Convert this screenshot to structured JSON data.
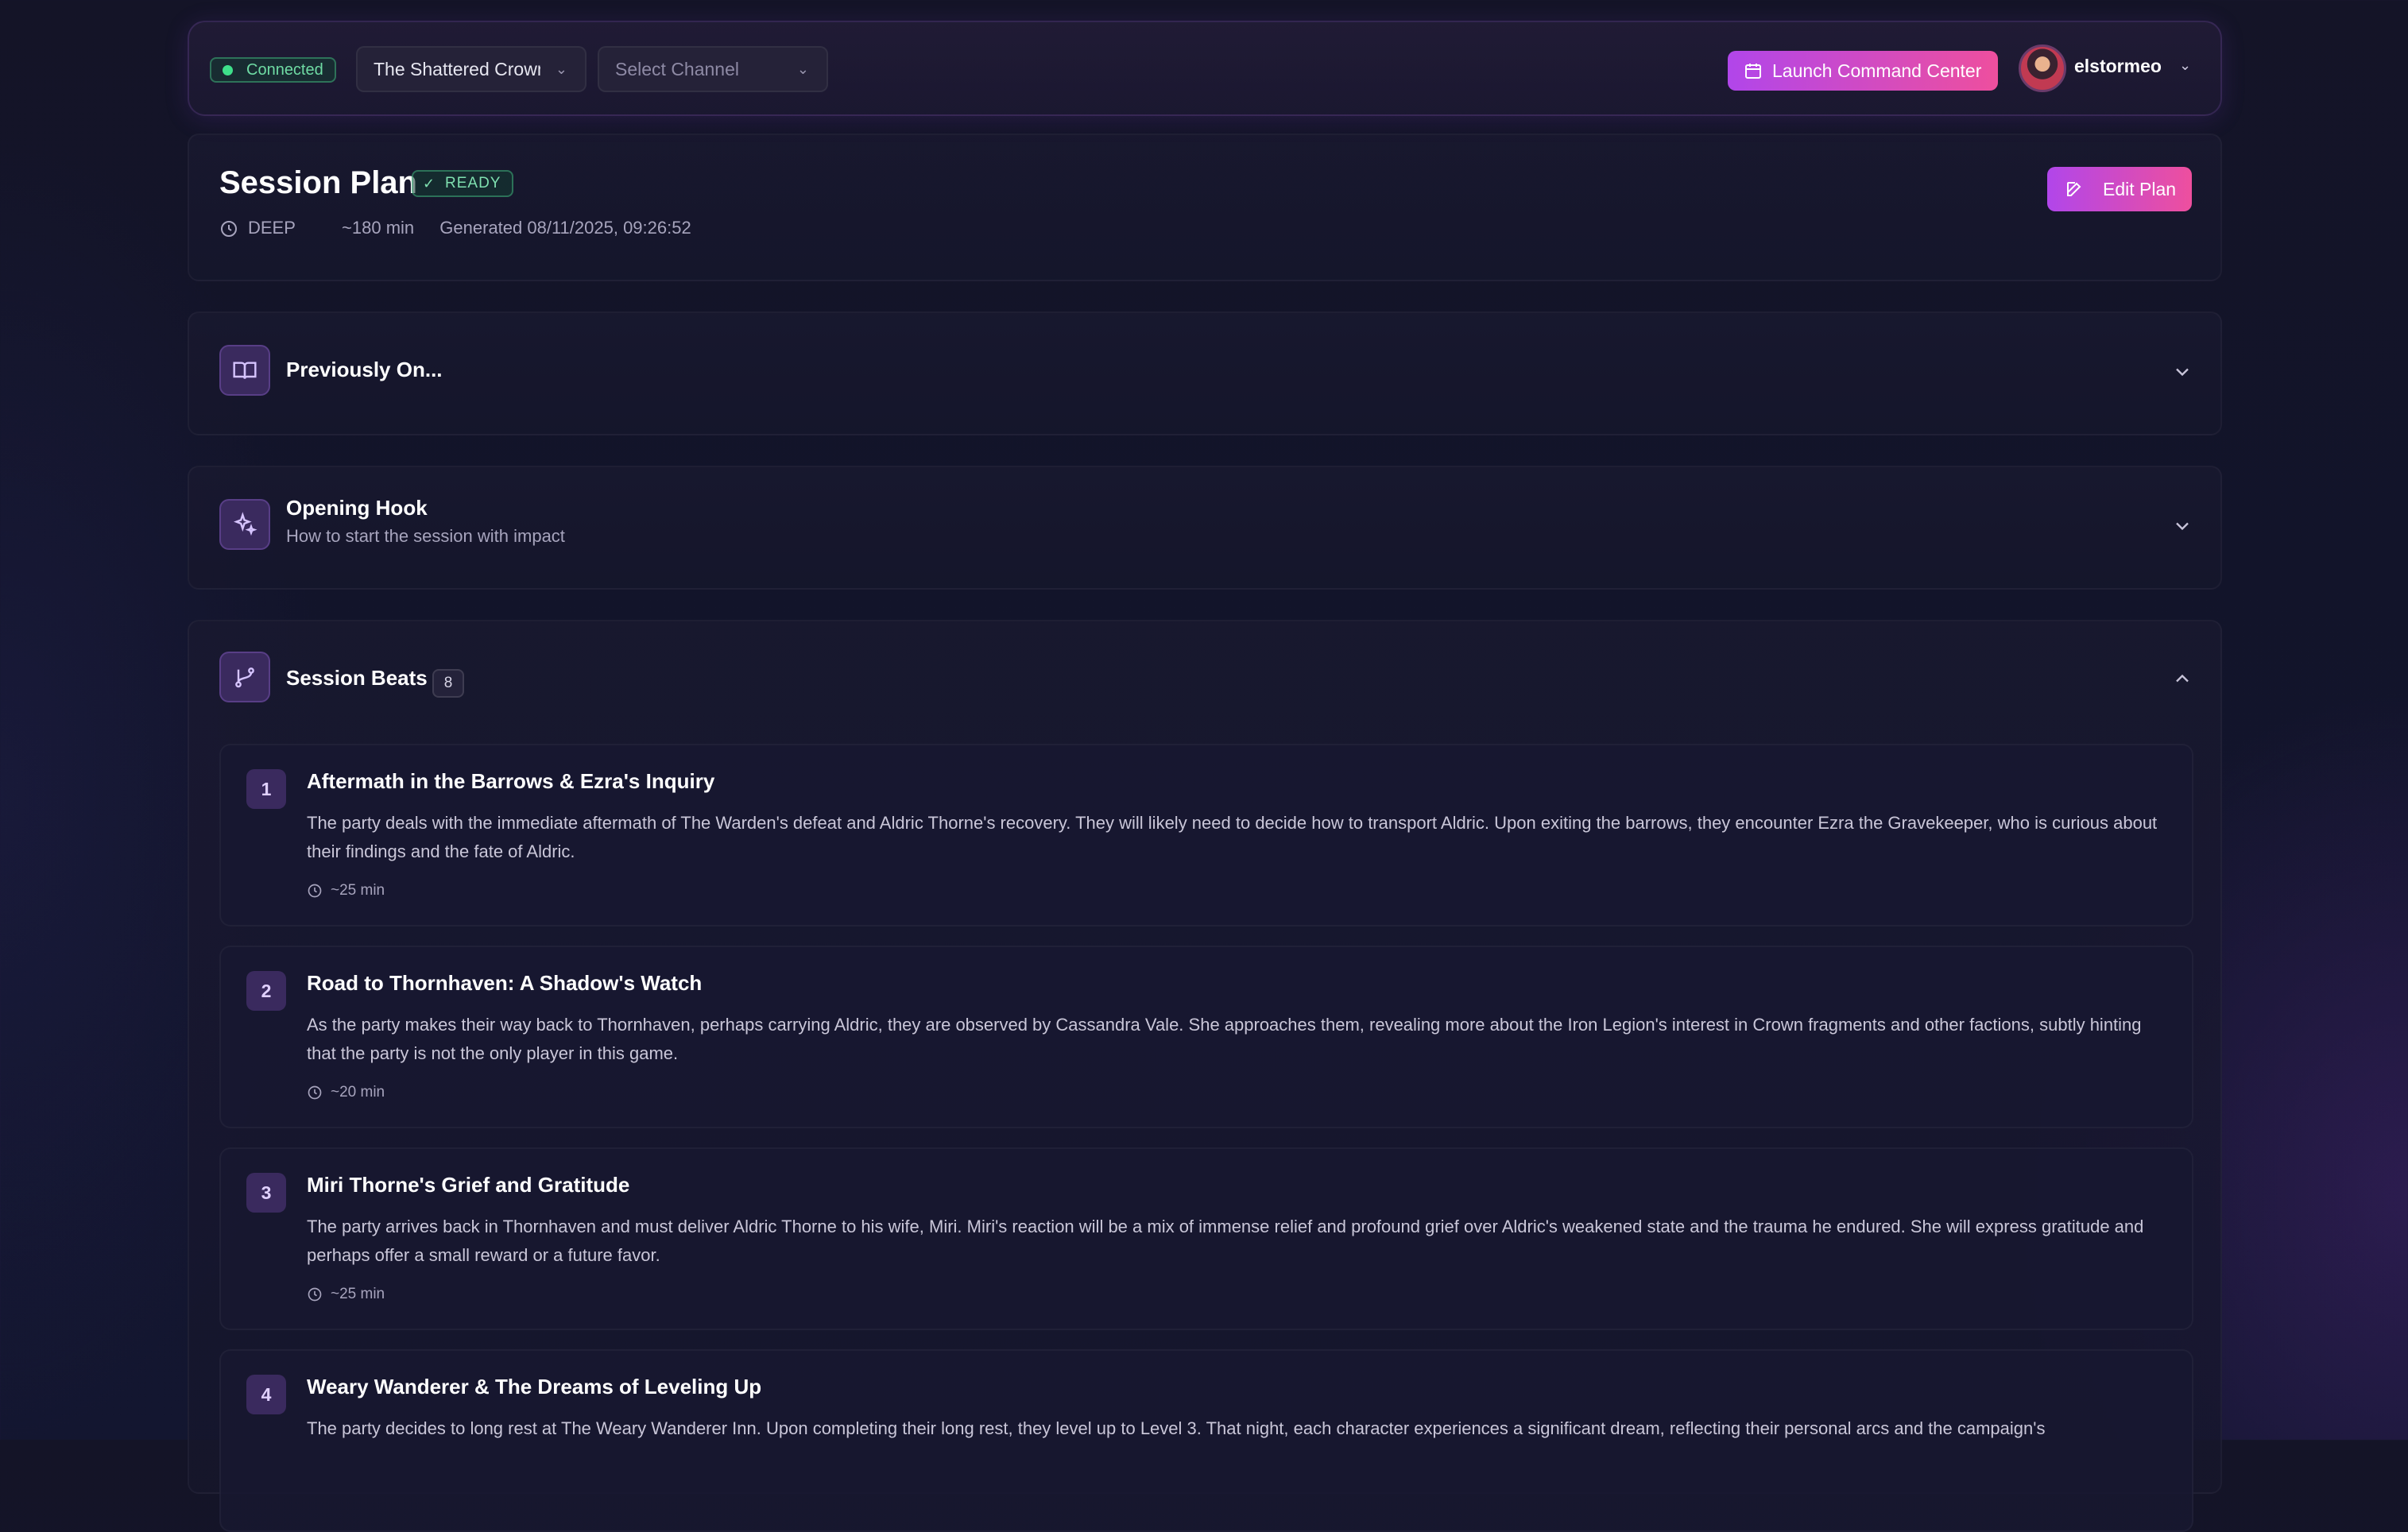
{
  "header": {
    "connection_status": "Connected",
    "campaign_select": "The Shattered Crown",
    "channel_placeholder": "Select Channel",
    "launch_label": "Launch Command Center",
    "username": "elstormeo"
  },
  "plan": {
    "title": "Session Plan",
    "status": "READY",
    "depth": "DEEP",
    "duration": "~180 min",
    "generated": "Generated 08/11/2025, 09:26:52",
    "edit_label": "Edit Plan"
  },
  "sections": {
    "previously": {
      "title": "Previously On..."
    },
    "hook": {
      "title": "Opening Hook",
      "subtitle": "How to start the session with impact"
    },
    "beats": {
      "title": "Session Beats",
      "count": "8"
    }
  },
  "beats": [
    {
      "number": "1",
      "title": "Aftermath in the Barrows & Ezra's Inquiry",
      "description": "The party deals with the immediate aftermath of The Warden's defeat and Aldric Thorne's recovery. They will likely need to decide how to transport Aldric. Upon exiting the barrows, they encounter Ezra the Gravekeeper, who is curious about their findings and the fate of Aldric.",
      "duration": "~25 min"
    },
    {
      "number": "2",
      "title": "Road to Thornhaven: A Shadow's Watch",
      "description": "As the party makes their way back to Thornhaven, perhaps carrying Aldric, they are observed by Cassandra Vale. She approaches them, revealing more about the Iron Legion's interest in Crown fragments and other factions, subtly hinting that the party is not the only player in this game.",
      "duration": "~20 min"
    },
    {
      "number": "3",
      "title": "Miri Thorne's Grief and Gratitude",
      "description": "The party arrives back in Thornhaven and must deliver Aldric Thorne to his wife, Miri. Miri's reaction will be a mix of immense relief and profound grief over Aldric's weakened state and the trauma he endured. She will express gratitude and perhaps offer a small reward or a future favor.",
      "duration": "~25 min"
    },
    {
      "number": "4",
      "title": "Weary Wanderer & The Dreams of Leveling Up",
      "description": "The party decides to long rest at The Weary Wanderer Inn. Upon completing their long rest, they level up to Level 3. That night, each character experiences a significant dream, reflecting their personal arcs and the campaign's",
      "duration": ""
    }
  ],
  "colors": {
    "accent_start": "#b146ea",
    "accent_end": "#ee4f9e",
    "success": "#3ee08a"
  }
}
